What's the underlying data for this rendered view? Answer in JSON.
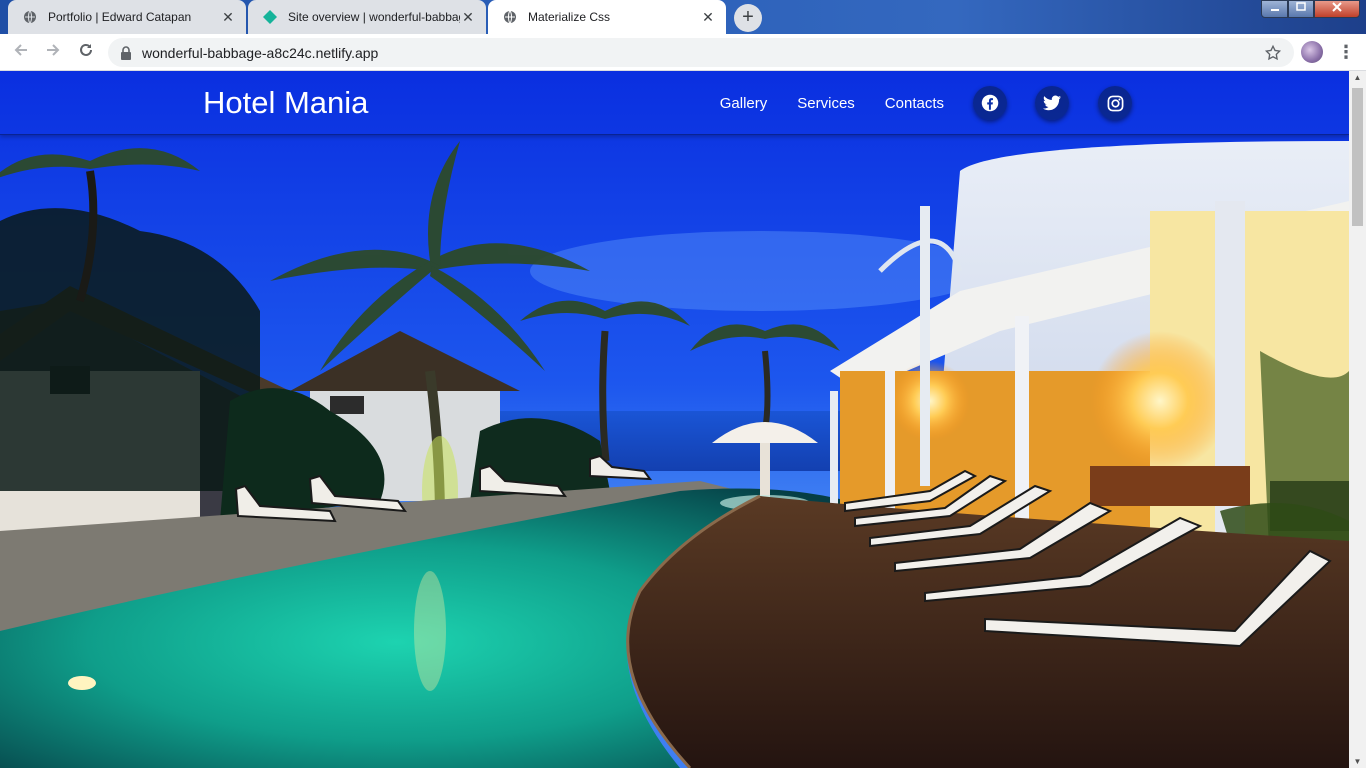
{
  "browser": {
    "tabs": [
      {
        "title": "Portfolio | Edward Catapan",
        "icon": "globe-icon",
        "active": false
      },
      {
        "title": "Site overview | wonderful-babbage",
        "icon": "netlify-icon",
        "active": false
      },
      {
        "title": "Materialize Css",
        "icon": "globe-icon",
        "active": true
      }
    ],
    "new_tab_label": "+",
    "close_label": "✕",
    "address": "wonderful-babbage-a8c24c.netlify.app"
  },
  "site": {
    "brand": "Hotel Mania",
    "nav": [
      {
        "label": "Gallery"
      },
      {
        "label": "Services"
      },
      {
        "label": "Contacts"
      }
    ],
    "social": [
      {
        "icon": "facebook-icon"
      },
      {
        "icon": "twitter-icon"
      },
      {
        "icon": "instagram-icon"
      }
    ]
  },
  "hero": {
    "subject": "resort pool at dusk"
  },
  "colors": {
    "accent": "#0d47ff",
    "text_on_hero": "#ffffff"
  }
}
